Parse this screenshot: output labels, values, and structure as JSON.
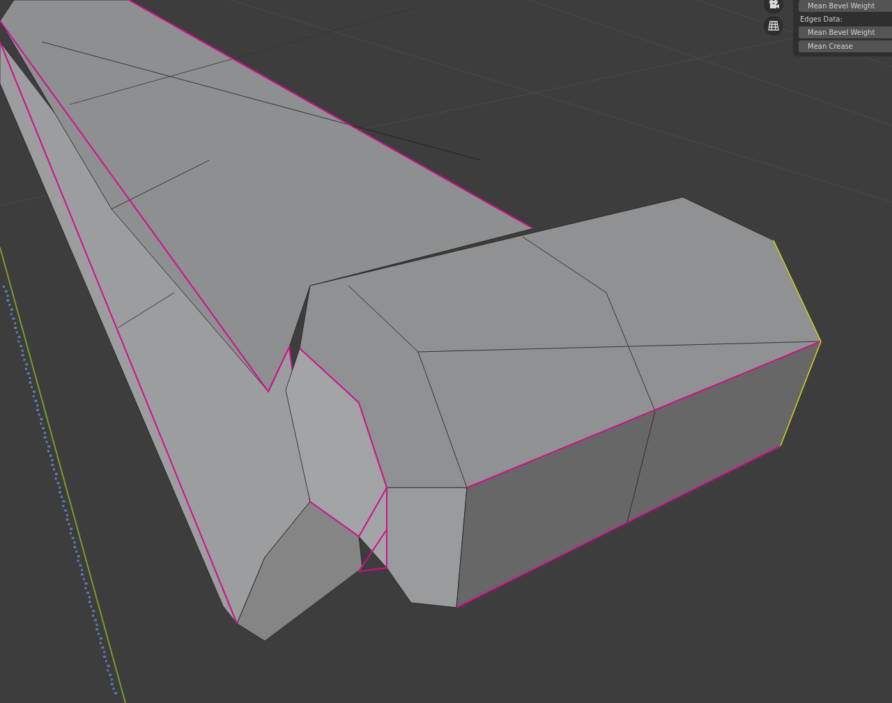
{
  "gizmo_buttons": [
    {
      "kind": "camera"
    },
    {
      "kind": "grid"
    }
  ],
  "panel": {
    "rows": [
      {
        "kind": "field",
        "label": "Mean Bevel Weight"
      },
      {
        "kind": "heading",
        "label": "Edges Data:"
      },
      {
        "kind": "field",
        "label": "Mean Bevel Weight"
      },
      {
        "kind": "field",
        "label": "Mean Crease"
      }
    ]
  }
}
